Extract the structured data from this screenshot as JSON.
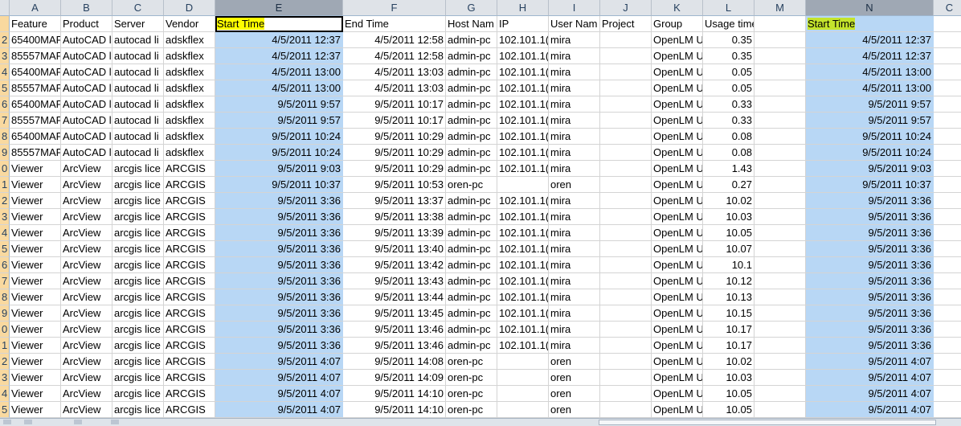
{
  "columns": [
    "",
    "A",
    "B",
    "C",
    "D",
    "E",
    "F",
    "G",
    "H",
    "I",
    "J",
    "K",
    "L",
    "M",
    "N",
    "C"
  ],
  "header_row": {
    "rownum": "",
    "A": "Feature",
    "B": "Product",
    "C": "Server",
    "D": "Vendor",
    "E": "Start Time",
    "F": "End Time",
    "G": "Host Nam",
    "H": "IP",
    "I": "User Nam",
    "J": "Project",
    "K": "Group",
    "L": "Usage time (hours)",
    "M": "",
    "N": "Start Time"
  },
  "rows": [
    {
      "n": "2",
      "A": "65400MAF",
      "B": "AutoCAD l",
      "C": "autocad li",
      "D": "adskflex",
      "E": "4/5/2011 12:37",
      "F": "4/5/2011 12:58",
      "G": "admin-pc",
      "H": "102.101.1(",
      "I": "mira",
      "J": "",
      "K": "OpenLM U",
      "L": "0.35",
      "N": "4/5/2011 12:37"
    },
    {
      "n": "3",
      "A": "85557MAF",
      "B": "AutoCAD l",
      "C": "autocad li",
      "D": "adskflex",
      "E": "4/5/2011 12:37",
      "F": "4/5/2011 12:58",
      "G": "admin-pc",
      "H": "102.101.1(",
      "I": "mira",
      "J": "",
      "K": "OpenLM U",
      "L": "0.35",
      "N": "4/5/2011 12:37"
    },
    {
      "n": "4",
      "A": "65400MAF",
      "B": "AutoCAD l",
      "C": "autocad li",
      "D": "adskflex",
      "E": "4/5/2011 13:00",
      "F": "4/5/2011 13:03",
      "G": "admin-pc",
      "H": "102.101.1(",
      "I": "mira",
      "J": "",
      "K": "OpenLM U",
      "L": "0.05",
      "N": "4/5/2011 13:00"
    },
    {
      "n": "5",
      "A": "85557MAF",
      "B": "AutoCAD l",
      "C": "autocad li",
      "D": "adskflex",
      "E": "4/5/2011 13:00",
      "F": "4/5/2011 13:03",
      "G": "admin-pc",
      "H": "102.101.1(",
      "I": "mira",
      "J": "",
      "K": "OpenLM U",
      "L": "0.05",
      "N": "4/5/2011 13:00"
    },
    {
      "n": "6",
      "A": "65400MAF",
      "B": "AutoCAD l",
      "C": "autocad li",
      "D": "adskflex",
      "E": "9/5/2011 9:57",
      "F": "9/5/2011 10:17",
      "G": "admin-pc",
      "H": "102.101.1(",
      "I": "mira",
      "J": "",
      "K": "OpenLM U",
      "L": "0.33",
      "N": "9/5/2011 9:57"
    },
    {
      "n": "7",
      "A": "85557MAF",
      "B": "AutoCAD l",
      "C": "autocad li",
      "D": "adskflex",
      "E": "9/5/2011 9:57",
      "F": "9/5/2011 10:17",
      "G": "admin-pc",
      "H": "102.101.1(",
      "I": "mira",
      "J": "",
      "K": "OpenLM U",
      "L": "0.33",
      "N": "9/5/2011 9:57"
    },
    {
      "n": "8",
      "A": "65400MAF",
      "B": "AutoCAD l",
      "C": "autocad li",
      "D": "adskflex",
      "E": "9/5/2011 10:24",
      "F": "9/5/2011 10:29",
      "G": "admin-pc",
      "H": "102.101.1(",
      "I": "mira",
      "J": "",
      "K": "OpenLM U",
      "L": "0.08",
      "N": "9/5/2011 10:24"
    },
    {
      "n": "9",
      "A": "85557MAF",
      "B": "AutoCAD l",
      "C": "autocad li",
      "D": "adskflex",
      "E": "9/5/2011 10:24",
      "F": "9/5/2011 10:29",
      "G": "admin-pc",
      "H": "102.101.1(",
      "I": "mira",
      "J": "",
      "K": "OpenLM U",
      "L": "0.08",
      "N": "9/5/2011 10:24"
    },
    {
      "n": "0",
      "A": "Viewer",
      "B": "ArcView",
      "C": "arcgis lice",
      "D": "ARCGIS",
      "E": "9/5/2011 9:03",
      "F": "9/5/2011 10:29",
      "G": "admin-pc",
      "H": "102.101.1(",
      "I": "mira",
      "J": "",
      "K": "OpenLM U",
      "L": "1.43",
      "N": "9/5/2011 9:03"
    },
    {
      "n": "1",
      "A": "Viewer",
      "B": "ArcView",
      "C": "arcgis lice",
      "D": "ARCGIS",
      "E": "9/5/2011 10:37",
      "F": "9/5/2011 10:53",
      "G": "oren-pc",
      "H": "",
      "I": "oren",
      "J": "",
      "K": "OpenLM U",
      "L": "0.27",
      "N": "9/5/2011 10:37"
    },
    {
      "n": "2",
      "A": "Viewer",
      "B": "ArcView",
      "C": "arcgis lice",
      "D": "ARCGIS",
      "E": "9/5/2011 3:36",
      "F": "9/5/2011 13:37",
      "G": "admin-pc",
      "H": "102.101.1(",
      "I": "mira",
      "J": "",
      "K": "OpenLM U",
      "L": "10.02",
      "N": "9/5/2011 3:36"
    },
    {
      "n": "3",
      "A": "Viewer",
      "B": "ArcView",
      "C": "arcgis lice",
      "D": "ARCGIS",
      "E": "9/5/2011 3:36",
      "F": "9/5/2011 13:38",
      "G": "admin-pc",
      "H": "102.101.1(",
      "I": "mira",
      "J": "",
      "K": "OpenLM U",
      "L": "10.03",
      "N": "9/5/2011 3:36"
    },
    {
      "n": "4",
      "A": "Viewer",
      "B": "ArcView",
      "C": "arcgis lice",
      "D": "ARCGIS",
      "E": "9/5/2011 3:36",
      "F": "9/5/2011 13:39",
      "G": "admin-pc",
      "H": "102.101.1(",
      "I": "mira",
      "J": "",
      "K": "OpenLM U",
      "L": "10.05",
      "N": "9/5/2011 3:36"
    },
    {
      "n": "5",
      "A": "Viewer",
      "B": "ArcView",
      "C": "arcgis lice",
      "D": "ARCGIS",
      "E": "9/5/2011 3:36",
      "F": "9/5/2011 13:40",
      "G": "admin-pc",
      "H": "102.101.1(",
      "I": "mira",
      "J": "",
      "K": "OpenLM U",
      "L": "10.07",
      "N": "9/5/2011 3:36"
    },
    {
      "n": "6",
      "A": "Viewer",
      "B": "ArcView",
      "C": "arcgis lice",
      "D": "ARCGIS",
      "E": "9/5/2011 3:36",
      "F": "9/5/2011 13:42",
      "G": "admin-pc",
      "H": "102.101.1(",
      "I": "mira",
      "J": "",
      "K": "OpenLM U",
      "L": "10.1",
      "N": "9/5/2011 3:36"
    },
    {
      "n": "7",
      "A": "Viewer",
      "B": "ArcView",
      "C": "arcgis lice",
      "D": "ARCGIS",
      "E": "9/5/2011 3:36",
      "F": "9/5/2011 13:43",
      "G": "admin-pc",
      "H": "102.101.1(",
      "I": "mira",
      "J": "",
      "K": "OpenLM U",
      "L": "10.12",
      "N": "9/5/2011 3:36"
    },
    {
      "n": "8",
      "A": "Viewer",
      "B": "ArcView",
      "C": "arcgis lice",
      "D": "ARCGIS",
      "E": "9/5/2011 3:36",
      "F": "9/5/2011 13:44",
      "G": "admin-pc",
      "H": "102.101.1(",
      "I": "mira",
      "J": "",
      "K": "OpenLM U",
      "L": "10.13",
      "N": "9/5/2011 3:36"
    },
    {
      "n": "9",
      "A": "Viewer",
      "B": "ArcView",
      "C": "arcgis lice",
      "D": "ARCGIS",
      "E": "9/5/2011 3:36",
      "F": "9/5/2011 13:45",
      "G": "admin-pc",
      "H": "102.101.1(",
      "I": "mira",
      "J": "",
      "K": "OpenLM U",
      "L": "10.15",
      "N": "9/5/2011 3:36"
    },
    {
      "n": "0",
      "A": "Viewer",
      "B": "ArcView",
      "C": "arcgis lice",
      "D": "ARCGIS",
      "E": "9/5/2011 3:36",
      "F": "9/5/2011 13:46",
      "G": "admin-pc",
      "H": "102.101.1(",
      "I": "mira",
      "J": "",
      "K": "OpenLM U",
      "L": "10.17",
      "N": "9/5/2011 3:36"
    },
    {
      "n": "1",
      "A": "Viewer",
      "B": "ArcView",
      "C": "arcgis lice",
      "D": "ARCGIS",
      "E": "9/5/2011 3:36",
      "F": "9/5/2011 13:46",
      "G": "admin-pc",
      "H": "102.101.1(",
      "I": "mira",
      "J": "",
      "K": "OpenLM U",
      "L": "10.17",
      "N": "9/5/2011 3:36"
    },
    {
      "n": "2",
      "A": "Viewer",
      "B": "ArcView",
      "C": "arcgis lice",
      "D": "ARCGIS",
      "E": "9/5/2011 4:07",
      "F": "9/5/2011 14:08",
      "G": "oren-pc",
      "H": "",
      "I": "oren",
      "J": "",
      "K": "OpenLM U",
      "L": "10.02",
      "N": "9/5/2011 4:07"
    },
    {
      "n": "3",
      "A": "Viewer",
      "B": "ArcView",
      "C": "arcgis lice",
      "D": "ARCGIS",
      "E": "9/5/2011 4:07",
      "F": "9/5/2011 14:09",
      "G": "oren-pc",
      "H": "",
      "I": "oren",
      "J": "",
      "K": "OpenLM U",
      "L": "10.03",
      "N": "9/5/2011 4:07"
    },
    {
      "n": "4",
      "A": "Viewer",
      "B": "ArcView",
      "C": "arcgis lice",
      "D": "ARCGIS",
      "E": "9/5/2011 4:07",
      "F": "9/5/2011 14:10",
      "G": "oren-pc",
      "H": "",
      "I": "oren",
      "J": "",
      "K": "OpenLM U",
      "L": "10.05",
      "N": "9/5/2011 4:07"
    },
    {
      "n": "5",
      "A": "Viewer",
      "B": "ArcView",
      "C": "arcgis lice",
      "D": "ARCGIS",
      "E": "9/5/2011 4:07",
      "F": "9/5/2011 14:10",
      "G": "oren-pc",
      "H": "",
      "I": "oren",
      "J": "",
      "K": "OpenLM U",
      "L": "10.05",
      "N": "9/5/2011 4:07"
    }
  ],
  "colors": {
    "selected_column_fill": "#b8d7f5",
    "header_highlight_yellow": "#ffff00",
    "header_highlight_green": "#c4e42c",
    "row_header_fill": "#f9d99f",
    "column_header_fill": "#dfe3e8"
  }
}
